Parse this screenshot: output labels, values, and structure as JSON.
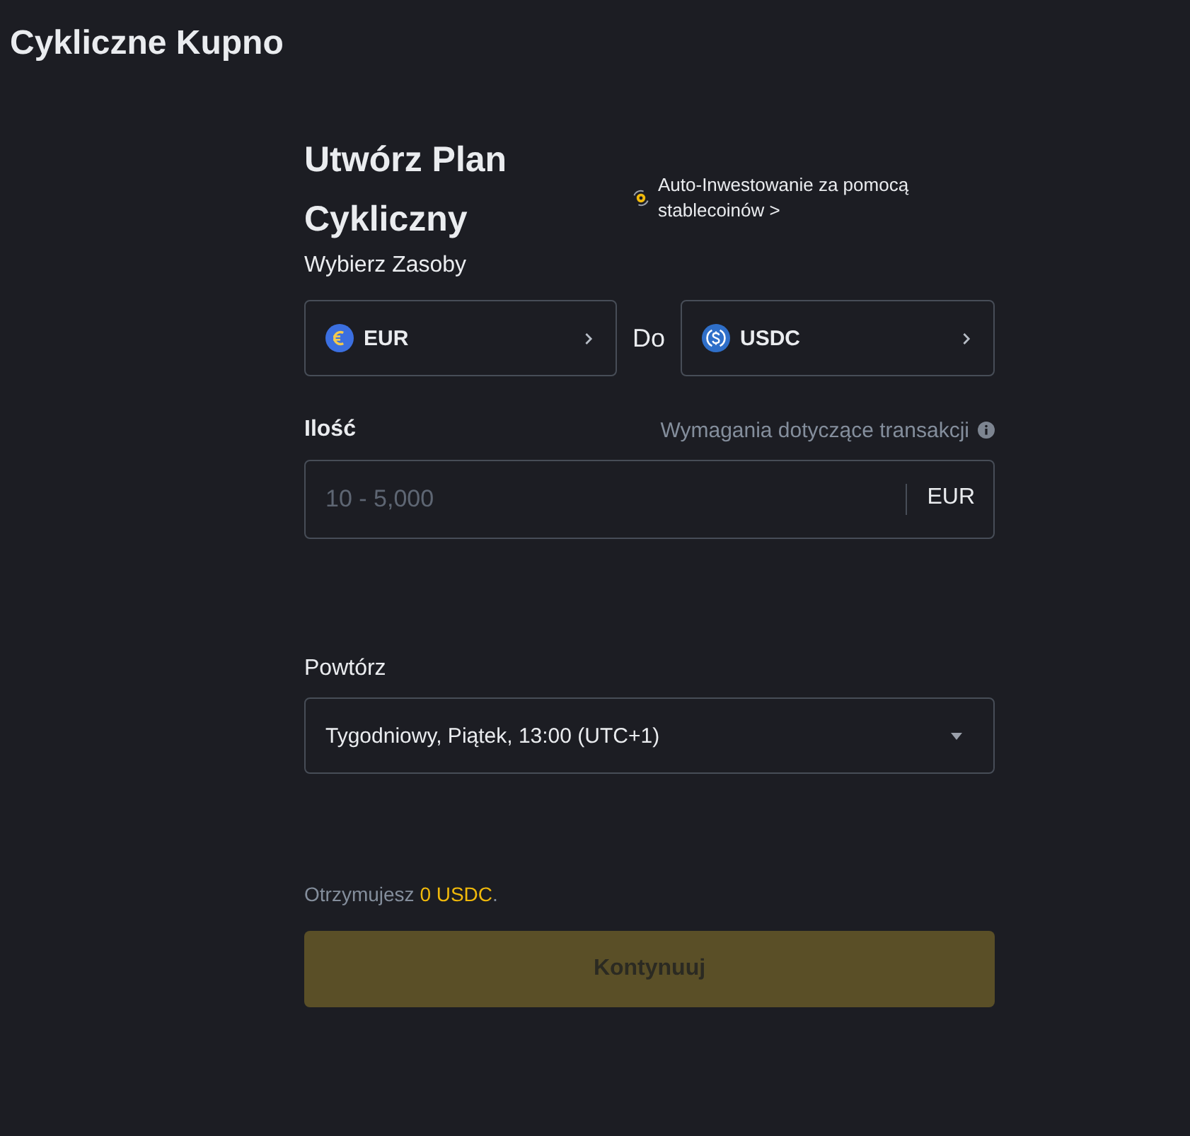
{
  "page": {
    "title": "Cykliczne Kupno"
  },
  "form": {
    "title": "Utwórz Plan Cykliczny",
    "promo_link": "Auto-Inwestowanie za pomocą stablecoinów >",
    "assets": {
      "label": "Wybierz Zasoby",
      "from": {
        "symbol": "EUR",
        "kind": "euro"
      },
      "connector": "Do",
      "to": {
        "symbol": "USDC",
        "kind": "usdc"
      }
    },
    "amount": {
      "label": "Ilość",
      "hint": "Wymagania dotyczące transakcji",
      "placeholder": "10 - 5,000",
      "currency": "EUR"
    },
    "repeat": {
      "label": "Powtórz",
      "value": "Tygodniowy, Piątek, 13:00 (UTC+1)"
    },
    "summary": "Otrzymujesz **0 USDC**.",
    "submit": {
      "label": "Kontynuuj",
      "disabled": true
    }
  }
}
